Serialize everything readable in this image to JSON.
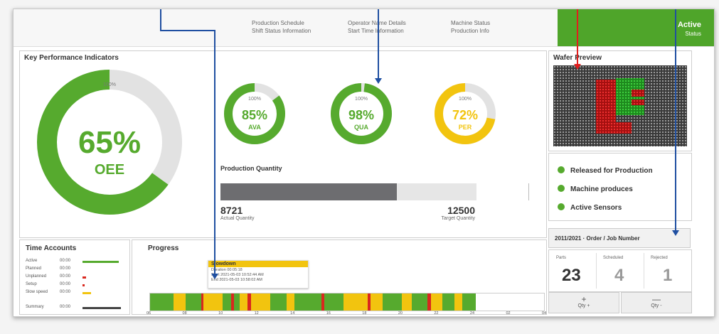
{
  "topbar": {
    "info": [
      {
        "line1": "Production Schedule",
        "line2": "Shift Status Information"
      },
      {
        "line1": "Operator Name Details",
        "line2": "Start Time Information"
      },
      {
        "line1": "Machine Status",
        "line2": "Production Info"
      }
    ],
    "status": "Active",
    "status_sub": "Status"
  },
  "kpi": {
    "title": "Key Performance Indicators",
    "oee": {
      "value": "65%",
      "label": "OEE",
      "pct": 0.65
    },
    "avail": {
      "value": "85%",
      "label": "AVA",
      "pct": 0.85
    },
    "qual": {
      "value": "98%",
      "label": "QUA",
      "pct": 0.98
    },
    "perf": {
      "value": "72%",
      "label": "PER",
      "pct": 0.72
    },
    "ring_caption": "100%"
  },
  "quantity": {
    "title": "Production Quantity",
    "actual": "8721",
    "actual_label": "Actual Quantity",
    "target": "12500",
    "target_label": "Target Quantity",
    "fill": 0.69
  },
  "preview": {
    "title": "Wafer Preview"
  },
  "legend": [
    {
      "label": "Released for Production"
    },
    {
      "label": "Machine produces"
    },
    {
      "label": "Active Sensors"
    }
  ],
  "order": {
    "label": "2011/2021 · Order / Job Number"
  },
  "counters": [
    {
      "label": "Parts",
      "value": "23",
      "color": "#333333"
    },
    {
      "label": "Scheduled",
      "value": "4",
      "color": "#9a9a9a"
    },
    {
      "label": "Rejected",
      "value": "1",
      "color": "#9a9a9a"
    }
  ],
  "buttons": [
    {
      "symbol": "+",
      "label": "Qty +"
    },
    {
      "symbol": "—",
      "label": "Qty -"
    }
  ],
  "time_accounts": {
    "title": "Time Accounts",
    "rows": [
      {
        "name": "Active",
        "value": "00:00",
        "color": "#56aa2e",
        "fill": 0.85
      },
      {
        "name": "Planned",
        "value": "00:00",
        "color": "#56aa2e",
        "fill": 0
      },
      {
        "name": "Unplanned",
        "value": "00:00",
        "color": "#d9281e",
        "fill": 0.08
      },
      {
        "name": "Setup",
        "value": "00:00",
        "color": "#d9281e",
        "fill": 0.05
      },
      {
        "name": "Slow speed",
        "value": "00:00",
        "color": "#f2c40f",
        "fill": 0.2
      },
      {
        "name": "Summary",
        "value": "00:00",
        "color": "#444444",
        "fill": 0.9
      }
    ]
  },
  "progress": {
    "title": "Progress",
    "tooltip": {
      "title": "Slowdown",
      "lines": [
        "Duration 00:05:18",
        "Start 2021-05-03 10:52:44 AM",
        "End 2021-05-03 10:58:02 AM"
      ]
    },
    "ticks": [
      "06",
      "08",
      "10",
      "12",
      "14",
      "16",
      "18",
      "20",
      "22",
      "24",
      "02",
      "04"
    ],
    "timeline": [
      {
        "color": "#56aa2e",
        "w": 0.06
      },
      {
        "color": "#f2c40f",
        "w": 0.03
      },
      {
        "color": "#56aa2e",
        "w": 0.04
      },
      {
        "color": "#d9281e",
        "w": 0.005
      },
      {
        "color": "#f2c40f",
        "w": 0.05
      },
      {
        "color": "#56aa2e",
        "w": 0.02
      },
      {
        "color": "#d9281e",
        "w": 0.008
      },
      {
        "color": "#56aa2e",
        "w": 0.015
      },
      {
        "color": "#f2c40f",
        "w": 0.02
      },
      {
        "color": "#d9281e",
        "w": 0.008
      },
      {
        "color": "#f2c40f",
        "w": 0.05
      },
      {
        "color": "#56aa2e",
        "w": 0.04
      },
      {
        "color": "#f2c40f",
        "w": 0.02
      },
      {
        "color": "#56aa2e",
        "w": 0.07
      },
      {
        "color": "#d9281e",
        "w": 0.006
      },
      {
        "color": "#56aa2e",
        "w": 0.05
      },
      {
        "color": "#f2c40f",
        "w": 0.06
      },
      {
        "color": "#d9281e",
        "w": 0.008
      },
      {
        "color": "#f2c40f",
        "w": 0.03
      },
      {
        "color": "#56aa2e",
        "w": 0.05
      },
      {
        "color": "#f2c40f",
        "w": 0.025
      },
      {
        "color": "#56aa2e",
        "w": 0.04
      },
      {
        "color": "#d9281e",
        "w": 0.008
      },
      {
        "color": "#f2c40f",
        "w": 0.03
      },
      {
        "color": "#56aa2e",
        "w": 0.03
      },
      {
        "color": "#f2c40f",
        "w": 0.02
      },
      {
        "color": "#56aa2e",
        "w": 0.035
      },
      {
        "color": "#ffffff",
        "w": 0.14
      }
    ]
  },
  "colors": {
    "green": "#56aa2e",
    "yellow": "#f2c40f",
    "red": "#d9281e",
    "ring_bg": "#e2e2e2",
    "pointer_blue": "#1f4fa1",
    "pointer_red": "#e21d1d"
  }
}
